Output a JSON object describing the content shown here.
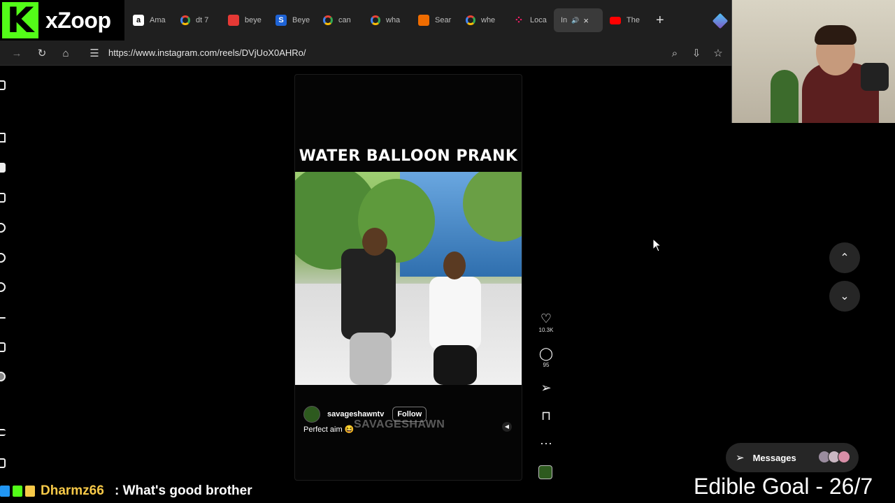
{
  "stream": {
    "logo_letter": "K",
    "channel_name": "xZoop"
  },
  "browser": {
    "tabs": [
      {
        "title": "Ama",
        "icon": "amazon-icon",
        "color": "#ffffff"
      },
      {
        "title": "dt 7",
        "icon": "google-icon",
        "color": "#ffffff"
      },
      {
        "title": "beye",
        "icon": "bookmark-red-icon",
        "color": "#e53935"
      },
      {
        "title": "Beye",
        "icon": "s-logo-icon",
        "color": "#1e63d6"
      },
      {
        "title": "can",
        "icon": "google-icon",
        "color": "#ffffff"
      },
      {
        "title": "wha",
        "icon": "google-icon",
        "color": "#ffffff"
      },
      {
        "title": "Sear",
        "icon": "search-site-icon",
        "color": "#ef6c00"
      },
      {
        "title": "whe",
        "icon": "google-icon",
        "color": "#ffffff"
      },
      {
        "title": "Loca",
        "icon": "dots-icon",
        "color": "#e91e63"
      },
      {
        "title": "In",
        "icon": "instagram-icon",
        "color": "#ffffff",
        "active": true
      },
      {
        "title": "The",
        "icon": "youtube-icon",
        "color": "#ff0000"
      }
    ],
    "new_tab_symbol": "+",
    "url": "https://www.instagram.com/reels/DVjUoX0AHRo/"
  },
  "reel": {
    "title": "WATER BALLOON PRANK",
    "author": "savageshawntv",
    "follow_label": "Follow",
    "caption": "Perfect aim 😆",
    "watermark": "SAVAGESHAWN",
    "likes": "10.3K",
    "comments": "95"
  },
  "messages": {
    "label": "Messages"
  },
  "chat": {
    "username": "Dharmz66",
    "message": ": What's good brother"
  },
  "goal": {
    "text": "Edible Goal - 26/7"
  }
}
